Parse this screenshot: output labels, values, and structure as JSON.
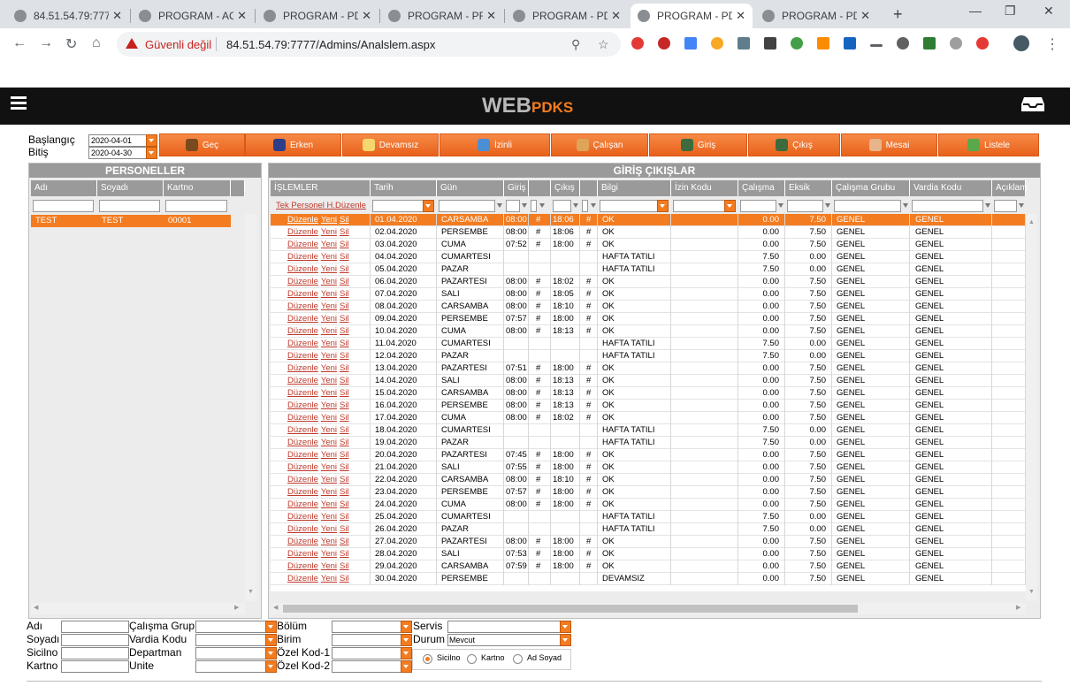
{
  "browser": {
    "tabs": [
      {
        "title": "84.51.54.79:7777",
        "active": false
      },
      {
        "title": "PROGRAM - AC",
        "active": false
      },
      {
        "title": "PROGRAM - PD",
        "active": false
      },
      {
        "title": "PROGRAM - PR",
        "active": false
      },
      {
        "title": "PROGRAM - PD",
        "active": false
      },
      {
        "title": "PROGRAM - PD",
        "active": true
      },
      {
        "title": "PROGRAM - PD",
        "active": false
      }
    ],
    "insecure_label": "Güvenli değil",
    "url": "84.51.54.79:7777/Admins/Analslem.aspx"
  },
  "header": {
    "brand_main": "WEB",
    "brand_sub": "PDKS"
  },
  "filters": {
    "start_label": "Başlangıç",
    "end_label": "Bitiş",
    "start_value": "2020-04-01",
    "end_value": "2020-04-30"
  },
  "actions": [
    "Geç",
    "Erken",
    "Devamsız",
    "İzinli",
    "Çalışan",
    "Giriş",
    "Çıkış",
    "Mesai",
    "Listele"
  ],
  "personnel": {
    "title": "PERSONELLER",
    "columns": [
      "Adı",
      "Soyadı",
      "Kartno"
    ],
    "rows": [
      [
        "TEST",
        "TEST",
        "00001"
      ]
    ]
  },
  "entries": {
    "title": "GİRİŞ ÇIKIŞLAR",
    "columns": [
      "İŞLEMLER",
      "Tarih",
      "Gün",
      "Giriş",
      "",
      "Çıkış",
      "",
      "Bilgi",
      "İzin Kodu",
      "Çalışma",
      "Eksik",
      "Çalışma Grubu",
      "Vardia Kodu",
      "Açıklam"
    ],
    "bulk_link": "Tek Personel H.Düzenle",
    "link_labels": [
      "Düzenle",
      "Yeni",
      "Sil"
    ],
    "rows": [
      [
        "01.04.2020",
        "CARSAMBA",
        "08:00",
        "#",
        "18:06",
        "#",
        "OK",
        "0.00",
        "7.50",
        "GENEL",
        "GENEL"
      ],
      [
        "02.04.2020",
        "PERSEMBE",
        "08:00",
        "#",
        "18:06",
        "#",
        "OK",
        "0.00",
        "7.50",
        "GENEL",
        "GENEL"
      ],
      [
        "03.04.2020",
        "CUMA",
        "07:52",
        "#",
        "18:00",
        "#",
        "OK",
        "0.00",
        "7.50",
        "GENEL",
        "GENEL"
      ],
      [
        "04.04.2020",
        "CUMARTESI",
        "",
        "",
        "",
        "",
        "HAFTA TATILI",
        "7.50",
        "0.00",
        "GENEL",
        "GENEL"
      ],
      [
        "05.04.2020",
        "PAZAR",
        "",
        "",
        "",
        "",
        "HAFTA TATILI",
        "7.50",
        "0.00",
        "GENEL",
        "GENEL"
      ],
      [
        "06.04.2020",
        "PAZARTESI",
        "08:00",
        "#",
        "18:02",
        "#",
        "OK",
        "0.00",
        "7.50",
        "GENEL",
        "GENEL"
      ],
      [
        "07.04.2020",
        "SALI",
        "08:00",
        "#",
        "18:05",
        "#",
        "OK",
        "0.00",
        "7.50",
        "GENEL",
        "GENEL"
      ],
      [
        "08.04.2020",
        "CARSAMBA",
        "08:00",
        "#",
        "18:10",
        "#",
        "OK",
        "0.00",
        "7.50",
        "GENEL",
        "GENEL"
      ],
      [
        "09.04.2020",
        "PERSEMBE",
        "07:57",
        "#",
        "18:00",
        "#",
        "OK",
        "0.00",
        "7.50",
        "GENEL",
        "GENEL"
      ],
      [
        "10.04.2020",
        "CUMA",
        "08:00",
        "#",
        "18:13",
        "#",
        "OK",
        "0.00",
        "7.50",
        "GENEL",
        "GENEL"
      ],
      [
        "11.04.2020",
        "CUMARTESI",
        "",
        "",
        "",
        "",
        "HAFTA TATILI",
        "7.50",
        "0.00",
        "GENEL",
        "GENEL"
      ],
      [
        "12.04.2020",
        "PAZAR",
        "",
        "",
        "",
        "",
        "HAFTA TATILI",
        "7.50",
        "0.00",
        "GENEL",
        "GENEL"
      ],
      [
        "13.04.2020",
        "PAZARTESI",
        "07:51",
        "#",
        "18:00",
        "#",
        "OK",
        "0.00",
        "7.50",
        "GENEL",
        "GENEL"
      ],
      [
        "14.04.2020",
        "SALI",
        "08:00",
        "#",
        "18:13",
        "#",
        "OK",
        "0.00",
        "7.50",
        "GENEL",
        "GENEL"
      ],
      [
        "15.04.2020",
        "CARSAMBA",
        "08:00",
        "#",
        "18:13",
        "#",
        "OK",
        "0.00",
        "7.50",
        "GENEL",
        "GENEL"
      ],
      [
        "16.04.2020",
        "PERSEMBE",
        "08:00",
        "#",
        "18:13",
        "#",
        "OK",
        "0.00",
        "7.50",
        "GENEL",
        "GENEL"
      ],
      [
        "17.04.2020",
        "CUMA",
        "08:00",
        "#",
        "18:02",
        "#",
        "OK",
        "0.00",
        "7.50",
        "GENEL",
        "GENEL"
      ],
      [
        "18.04.2020",
        "CUMARTESI",
        "",
        "",
        "",
        "",
        "HAFTA TATILI",
        "7.50",
        "0.00",
        "GENEL",
        "GENEL"
      ],
      [
        "19.04.2020",
        "PAZAR",
        "",
        "",
        "",
        "",
        "HAFTA TATILI",
        "7.50",
        "0.00",
        "GENEL",
        "GENEL"
      ],
      [
        "20.04.2020",
        "PAZARTESI",
        "07:45",
        "#",
        "18:00",
        "#",
        "OK",
        "0.00",
        "7.50",
        "GENEL",
        "GENEL"
      ],
      [
        "21.04.2020",
        "SALI",
        "07:55",
        "#",
        "18:00",
        "#",
        "OK",
        "0.00",
        "7.50",
        "GENEL",
        "GENEL"
      ],
      [
        "22.04.2020",
        "CARSAMBA",
        "08:00",
        "#",
        "18:10",
        "#",
        "OK",
        "0.00",
        "7.50",
        "GENEL",
        "GENEL"
      ],
      [
        "23.04.2020",
        "PERSEMBE",
        "07:57",
        "#",
        "18:00",
        "#",
        "OK",
        "0.00",
        "7.50",
        "GENEL",
        "GENEL"
      ],
      [
        "24.04.2020",
        "CUMA",
        "08:00",
        "#",
        "18:00",
        "#",
        "OK",
        "0.00",
        "7.50",
        "GENEL",
        "GENEL"
      ],
      [
        "25.04.2020",
        "CUMARTESI",
        "",
        "",
        "",
        "",
        "HAFTA TATILI",
        "7.50",
        "0.00",
        "GENEL",
        "GENEL"
      ],
      [
        "26.04.2020",
        "PAZAR",
        "",
        "",
        "",
        "",
        "HAFTA TATILI",
        "7.50",
        "0.00",
        "GENEL",
        "GENEL"
      ],
      [
        "27.04.2020",
        "PAZARTESI",
        "08:00",
        "#",
        "18:00",
        "#",
        "OK",
        "0.00",
        "7.50",
        "GENEL",
        "GENEL"
      ],
      [
        "28.04.2020",
        "SALI",
        "07:53",
        "#",
        "18:00",
        "#",
        "OK",
        "0.00",
        "7.50",
        "GENEL",
        "GENEL"
      ],
      [
        "29.04.2020",
        "CARSAMBA",
        "07:59",
        "#",
        "18:00",
        "#",
        "OK",
        "0.00",
        "7.50",
        "GENEL",
        "GENEL"
      ],
      [
        "30.04.2020",
        "PERSEMBE",
        "",
        "",
        "",
        "",
        "DEVAMSIZ",
        "0.00",
        "7.50",
        "GENEL",
        "GENEL"
      ]
    ]
  },
  "search_form": {
    "col1": [
      "Adı",
      "Soyadı",
      "Sicilno",
      "Kartno"
    ],
    "col2": [
      "Çalışma Grup",
      "Vardia Kodu",
      "Departman",
      "Unite"
    ],
    "col3": [
      "Bölüm",
      "Birim",
      "Özel Kod-1",
      "Özel Kod-2"
    ],
    "servis_label": "Servis",
    "durum_label": "Durum",
    "durum_value": "Mevcut",
    "radios": [
      "Sicilno",
      "Kartno",
      "Ad Soyad"
    ],
    "selected_radio": "Sicilno"
  },
  "colors": {
    "accent": "#f47c20",
    "header_bg": "#111111",
    "grid_header": "#9a9a9a"
  }
}
